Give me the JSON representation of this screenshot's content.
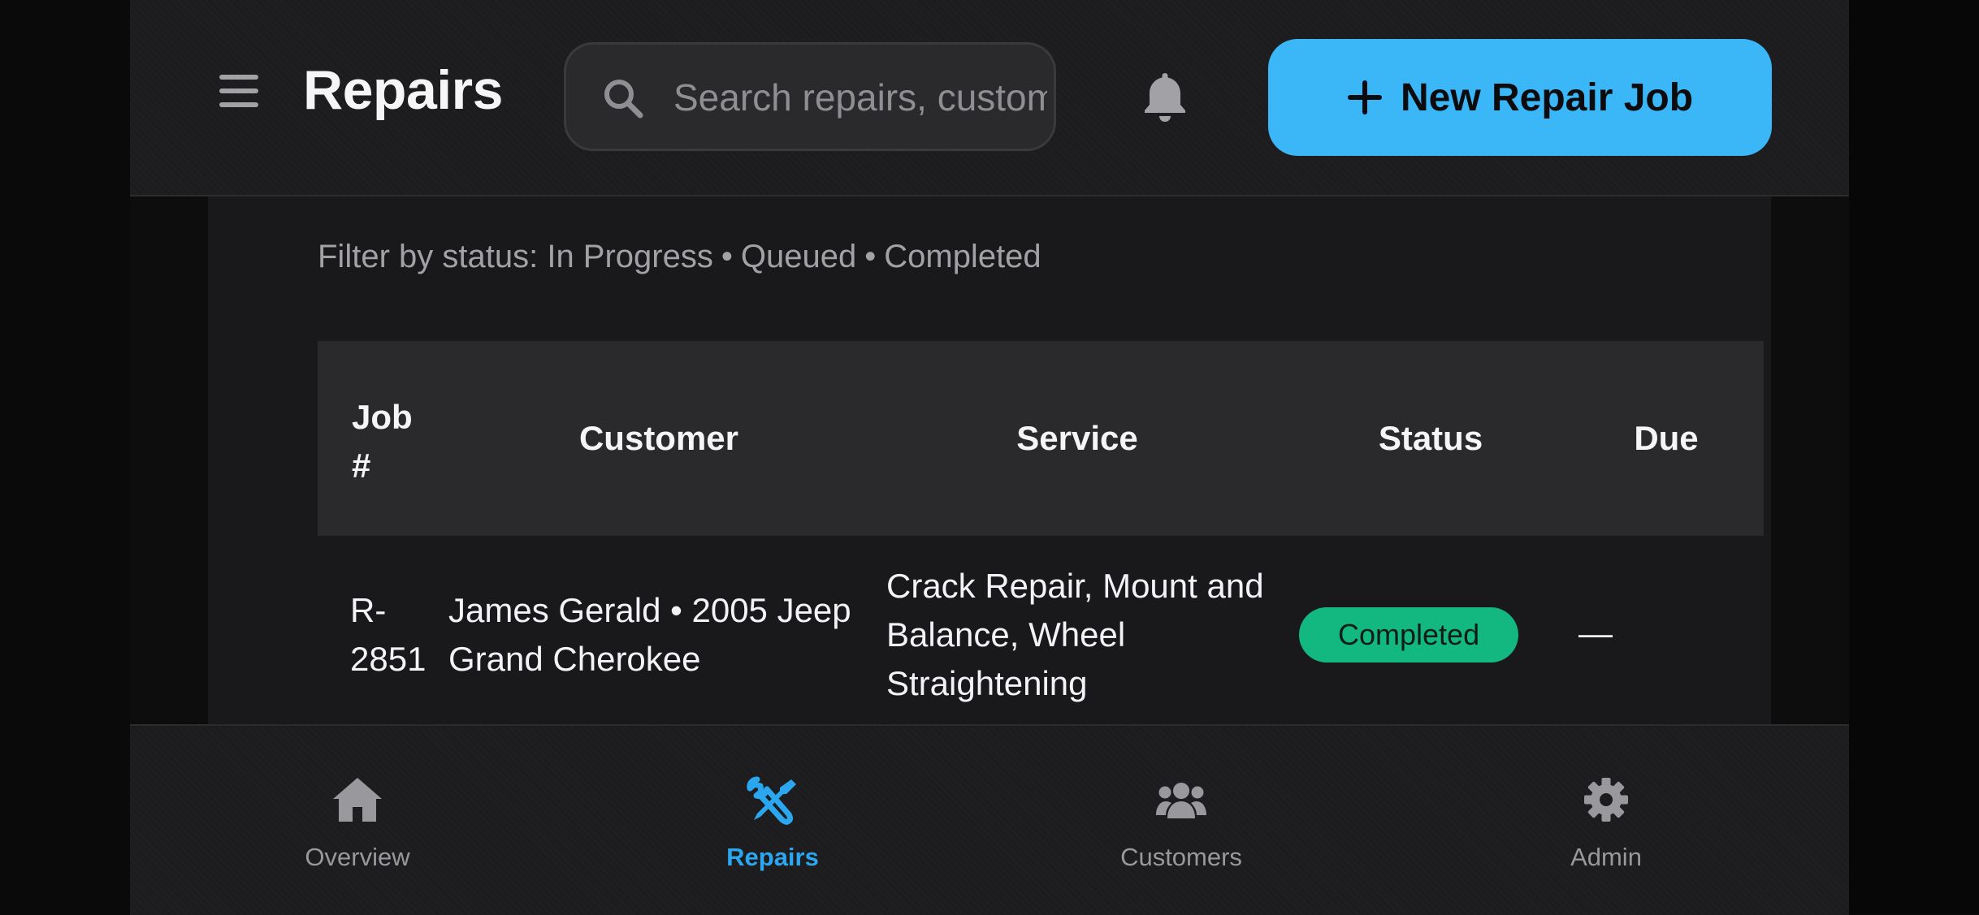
{
  "header": {
    "title": "Repairs",
    "search_placeholder": "Search repairs, customers",
    "new_job_label": "New Repair Job"
  },
  "filter": {
    "prefix": "Filter by status:",
    "options": [
      "In Progress",
      "Queued",
      "Completed"
    ],
    "separator": "•"
  },
  "table": {
    "columns": [
      "Job #",
      "Customer",
      "Service",
      "Status",
      "Due"
    ],
    "rows": [
      {
        "job": "R-2851",
        "customer": "James Gerald • 2005 Jeep Grand Cherokee",
        "service": "Crack Repair, Mount and Balance, Wheel Straightening",
        "status": "Completed",
        "due": "—"
      }
    ]
  },
  "nav": {
    "items": [
      {
        "label": "Overview",
        "icon": "home-icon"
      },
      {
        "label": "Repairs",
        "icon": "wrench-screwdriver-icon",
        "active": true
      },
      {
        "label": "Customers",
        "icon": "users-icon"
      },
      {
        "label": "Admin",
        "icon": "gear-icon"
      }
    ]
  },
  "colors": {
    "accent": "#3bb6f7",
    "active_nav": "#2aa7ef",
    "status_completed": "#13b881",
    "background": "#161618"
  }
}
